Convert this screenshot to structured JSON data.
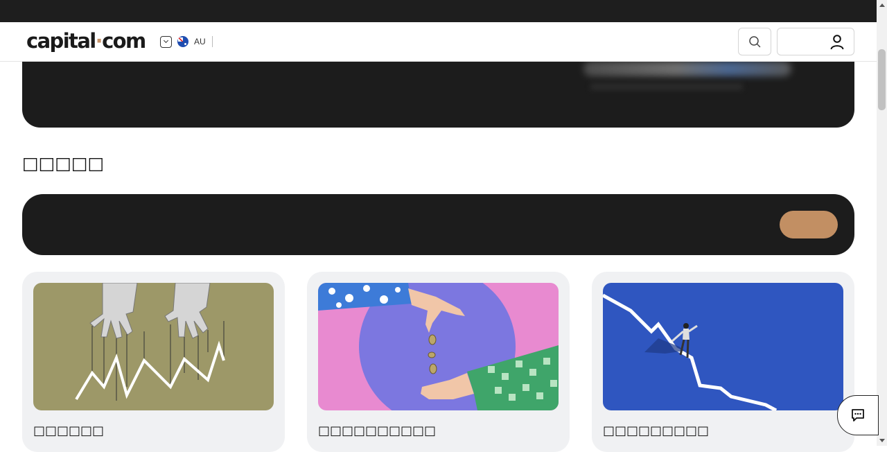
{
  "header": {
    "logo_text_left": "capital",
    "logo_dot": "·",
    "logo_text_right": "com",
    "region_code": "AU",
    "region_flag": "australia-flag-icon",
    "search_icon": "search-icon",
    "account_icon": "user-icon"
  },
  "section": {
    "title": "□□□□□"
  },
  "cards": [
    {
      "title": "□□□□□□",
      "image": "puppet-hands-market-chart"
    },
    {
      "title": "□□□□□□□□□□",
      "image": "hands-dropping-coins"
    },
    {
      "title": "□□□□□□□□□",
      "image": "man-walking-down-chart"
    }
  ],
  "colors": {
    "topbar": "#1e1e1e",
    "dark_panel": "#1c1c1c",
    "accent": "#c28f63",
    "card_bg": "#f0f1f3"
  },
  "chat": {
    "icon": "chat-icon"
  }
}
